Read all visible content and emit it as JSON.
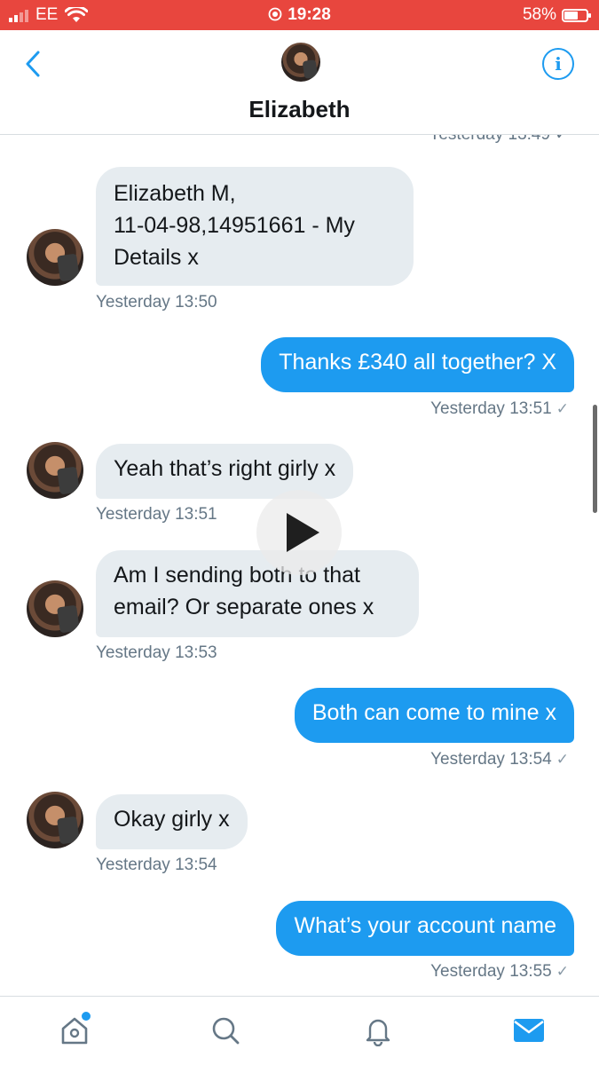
{
  "status_bar": {
    "carrier": "EE",
    "time": "19:28",
    "battery": "58%",
    "battery_level": 0.58,
    "background_color": "#e8463e"
  },
  "header": {
    "back_icon": "chevron-left-icon",
    "title": "Elizabeth",
    "info_icon": "info-icon"
  },
  "conversation": {
    "cut_off_timestamp": "Yesterday 13:49",
    "messages": [
      {
        "direction": "incoming",
        "text_lines": [
          "Elizabeth M,",
          "11-04-98,14951661 - My",
          "Details x"
        ],
        "timestamp": "Yesterday 13:50"
      },
      {
        "direction": "outgoing",
        "text": "Thanks £340 all together? X",
        "timestamp": "Yesterday 13:51",
        "status_icon": "checkmark-icon"
      },
      {
        "direction": "incoming",
        "text": "Yeah that’s right girly x",
        "timestamp": "Yesterday 13:51"
      },
      {
        "direction": "incoming",
        "text_lines": [
          "Am I sending both to that",
          "email? Or separate ones x"
        ],
        "timestamp": "Yesterday 13:53"
      },
      {
        "direction": "outgoing",
        "text": "Both can come to mine x",
        "timestamp": "Yesterday 13:54",
        "status_icon": "checkmark-icon"
      },
      {
        "direction": "incoming",
        "text": "Okay girly x",
        "timestamp": "Yesterday 13:54"
      },
      {
        "direction": "outgoing",
        "text": "What’s your account name",
        "timestamp": "Yesterday 13:55",
        "status_icon": "checkmark-icon"
      }
    ],
    "check_mark": "✓"
  },
  "overlay": {
    "icon": "play-icon"
  },
  "tab_bar": {
    "items": [
      {
        "icon": "home-icon",
        "has_notification": true
      },
      {
        "icon": "search-icon"
      },
      {
        "icon": "bell-icon"
      },
      {
        "icon": "mail-icon",
        "active": true
      }
    ]
  },
  "colors": {
    "accent": "#1d9bf0",
    "incoming_bubble": "#e6ecf0",
    "timestamp": "#657786"
  }
}
